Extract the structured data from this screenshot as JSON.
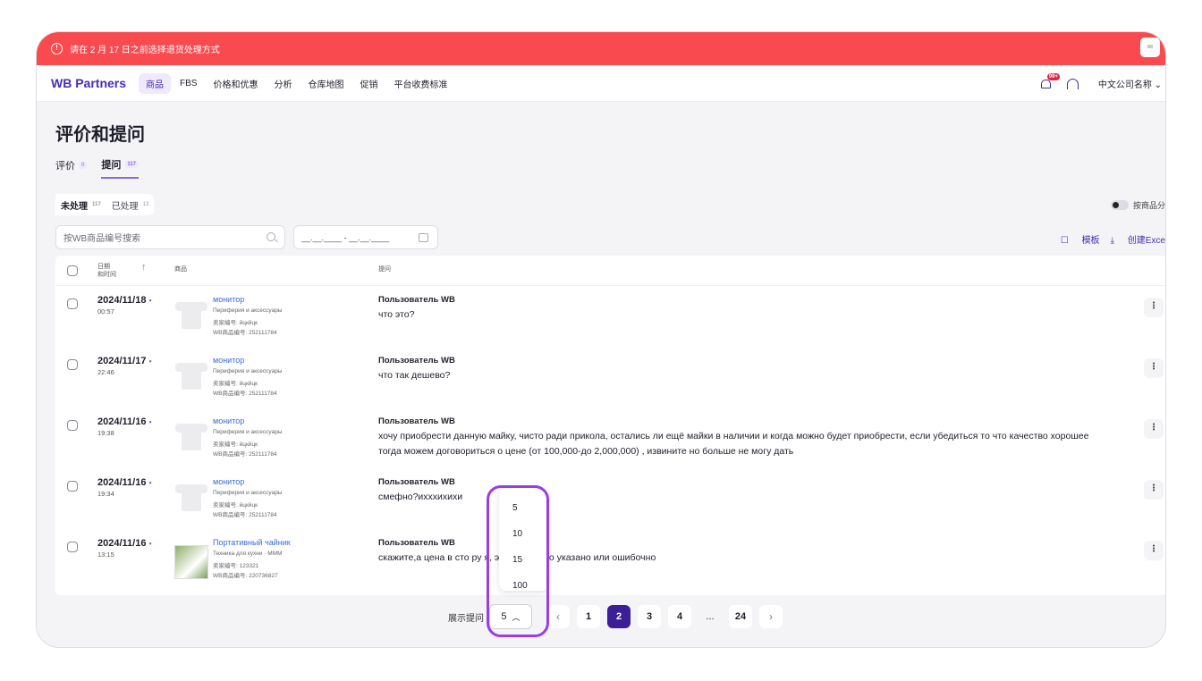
{
  "alert": {
    "text": "请在 2 月 17 日之前选择退货处理方式",
    "button": "✉"
  },
  "nav": {
    "logo": "WB Partners",
    "items": [
      "商品",
      "FBS",
      "价格和优惠",
      "分析",
      "仓库地图",
      "促销",
      "平台收费标准"
    ],
    "notif_badge": "99+",
    "company": "中文公司名称 ⌄"
  },
  "page": {
    "title": "评价和提问",
    "tabs": [
      {
        "label": "评价",
        "count": "0"
      },
      {
        "label": "提问",
        "count": "117"
      }
    ],
    "segments": [
      {
        "label": "未处理",
        "count": "117"
      },
      {
        "label": "已处理",
        "count": "13"
      }
    ],
    "group_toggle": "按商品分",
    "search_placeholder": "按WB商品编号搜索",
    "date_placeholder": "__.__.____ - __.__.____",
    "action_template": "模板",
    "action_export": "创建Exce"
  },
  "table": {
    "header": {
      "datetime": "日期\n和时间",
      "product": "商品",
      "question": "提问"
    },
    "rows": [
      {
        "date": "2024/11/18",
        "time": "00:57",
        "pname": "монитор",
        "pcat": "Периферия и аксессуары",
        "psku": "卖家编号:  йцкйцк",
        "pwb": "WB商品编号: 252111784",
        "user": "Пользователь WB",
        "question": "что это?",
        "img": "shirt"
      },
      {
        "date": "2024/11/17",
        "time": "22:46",
        "pname": "монитор",
        "pcat": "Периферия и аксессуары",
        "psku": "卖家编号:  йцкйцк",
        "pwb": "WB商品编号: 252111784",
        "user": "Пользователь WB",
        "question": "что так дешево?",
        "img": "shirt"
      },
      {
        "date": "2024/11/16",
        "time": "19:38",
        "pname": "монитор",
        "pcat": "Периферия и аксессуары",
        "psku": "卖家编号:  йцкйцк",
        "pwb": "WB商品编号: 252111784",
        "user": "Пользователь WB",
        "question": "хочу приобрести данную майку, чисто ради прикола, остались ли ещё майки в наличии и когда можно будет приобрести, если убедиться то что качество хорошее тогда можем договориться о цене (от 100,000-до 2,000,000) , извините но больше не могу дать",
        "img": "shirt"
      },
      {
        "date": "2024/11/16",
        "time": "19:34",
        "pname": "монитор",
        "pcat": "Периферия и аксессуары",
        "psku": "卖家编号:  йцкйцк",
        "pwb": "WB商品编号: 252111784",
        "user": "Пользователь WB",
        "question": "смефно?ихххихихи",
        "img": "shirt"
      },
      {
        "date": "2024/11/16",
        "time": "13:15",
        "pname": "Портативный чайник",
        "pcat": "Техника для кухни · МММ",
        "psku": "卖家编号:  123321",
        "pwb": "WB商品编号: 220736827",
        "user": "Пользователь WB",
        "question": "скажите,а цена в сто ру       я, это всё верно указано или ошибочно",
        "img": "kettle"
      }
    ]
  },
  "pager": {
    "label": "展示提问",
    "page_size": "5",
    "pages": [
      "1",
      "2",
      "3",
      "4",
      "...",
      "24"
    ],
    "current": "2",
    "dropdown_options": [
      "5",
      "10",
      "15",
      "100"
    ]
  },
  "colors": {
    "alert": "#f84a4f",
    "brand": "#4a2bb5",
    "active_page": "#3c1f96",
    "highlight": "#9b3de6"
  }
}
